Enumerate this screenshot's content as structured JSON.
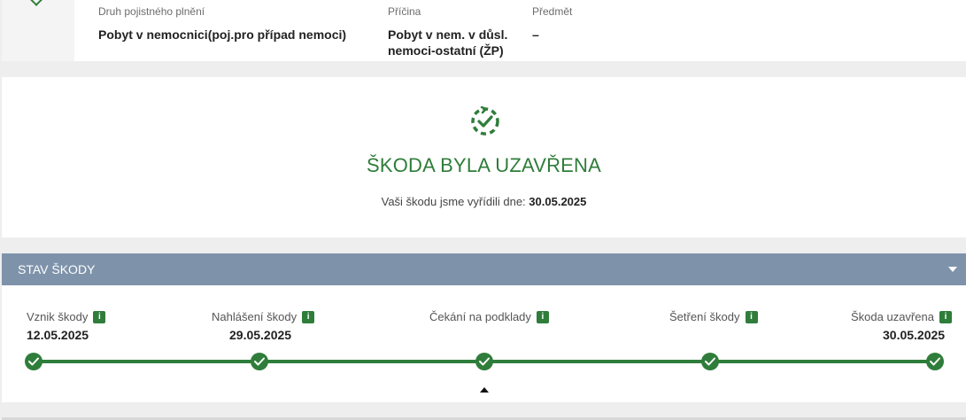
{
  "claim_info": {
    "type_label": "Druh pojistného plnění",
    "type_value": "Pobyt v nemocnici(poj.pro případ nemoci)",
    "cause_label": "Příčina",
    "cause_value_line1": "Pobyt v nem. v důsl.",
    "cause_value_line2": "nemoci-ostatní (ŽP)",
    "subject_label": "Předmět",
    "subject_value": "–"
  },
  "closed": {
    "icon": "closed-check-icon",
    "title": "ŠKODA BYLA UZAVŘENA",
    "sub_prefix": "Vaši škodu jsme vyřídili dne:",
    "sub_date": "30.05.2025"
  },
  "status": {
    "title": "STAV ŠKODY",
    "steps": [
      {
        "label": "Vznik škody",
        "date": "12.05.2025"
      },
      {
        "label": "Nahlášení škody",
        "date": "29.05.2025"
      },
      {
        "label": "Čekání na podklady",
        "date": ""
      },
      {
        "label": "Šetření škody",
        "date": ""
      },
      {
        "label": "Škoda uzavřena",
        "date": "30.05.2025"
      }
    ],
    "info_badge": "i"
  },
  "colors": {
    "accent": "#2f7d3a",
    "header": "#7e93aa"
  }
}
